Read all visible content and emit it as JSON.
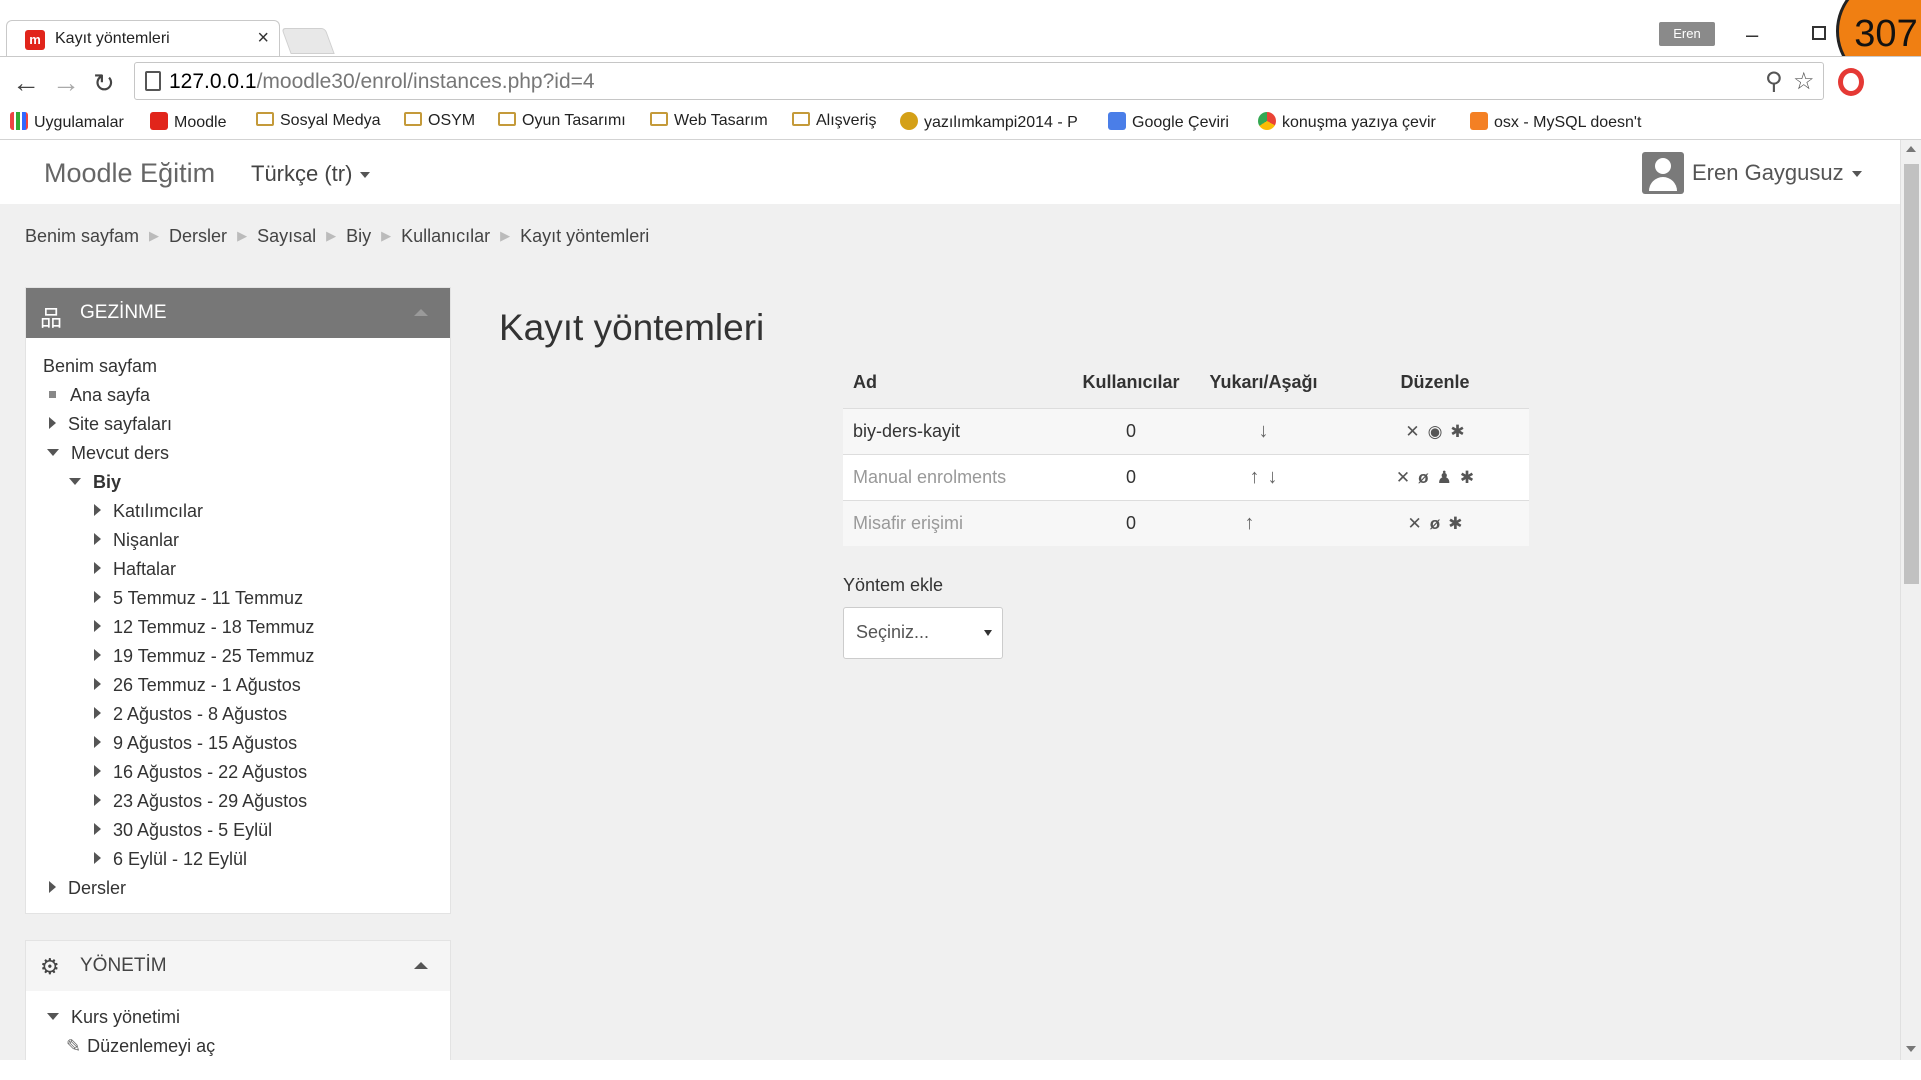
{
  "browser": {
    "tab_title": "Kayıt yöntemleri",
    "url_host": "127.0.0.1",
    "url_path": "/moodle30/enrol/instances.php?id=4",
    "profile": "Eren",
    "counter": "307",
    "bookmarks": [
      "Uygulamalar",
      "Moodle",
      "Sosyal Medya",
      "OSYM",
      "Oyun Tasarımı",
      "Web Tasarım",
      "Alışveriş",
      "yazılımkampi2014 - P",
      "Google Çeviri",
      "konuşma yazıya çevir",
      "osx - MySQL doesn't"
    ]
  },
  "navbar": {
    "brand": "Moodle Eğitim",
    "language": "Türkçe (tr)",
    "user": "Eren Gaygusuz"
  },
  "breadcrumb": [
    "Benim sayfam",
    "Dersler",
    "Sayısal",
    "Biy",
    "Kullanıcılar",
    "Kayıt yöntemleri"
  ],
  "nav_block": {
    "title": "GEZİNME",
    "items": [
      "Benim sayfam",
      "Ana sayfa",
      "Site sayfaları",
      "Mevcut ders",
      "Biy",
      "Katılımcılar",
      "Nişanlar",
      "Haftalar",
      "5 Temmuz - 11 Temmuz",
      "12 Temmuz - 18 Temmuz",
      "19 Temmuz - 25 Temmuz",
      "26 Temmuz - 1 Ağustos",
      "2 Ağustos - 8 Ağustos",
      "9 Ağustos - 15 Ağustos",
      "16 Ağustos - 22 Ağustos",
      "23 Ağustos - 29 Ağustos",
      "30 Ağustos - 5 Eylül",
      "6 Eylül - 12 Eylül",
      "Dersler"
    ]
  },
  "admin_block": {
    "title": "YÖNETİM",
    "items": [
      "Kurs yönetimi",
      "Düzenlemeyi aç"
    ]
  },
  "main": {
    "heading": "Kayıt yöntemleri",
    "table": {
      "headers": [
        "Ad",
        "Kullanıcılar",
        "Yukarı/Aşağı",
        "Düzenle"
      ],
      "rows": [
        {
          "name": "biy-ders-kayit",
          "users": "0"
        },
        {
          "name": "Manual enrolments",
          "users": "0"
        },
        {
          "name": "Misafir erişimi",
          "users": "0"
        }
      ]
    },
    "add_method_label": "Yöntem ekle",
    "add_method_select": "Seçiniz..."
  },
  "colors": {
    "block_header": "#777777",
    "page_bg": "#f0f0f0",
    "counter": "#f07f12"
  }
}
